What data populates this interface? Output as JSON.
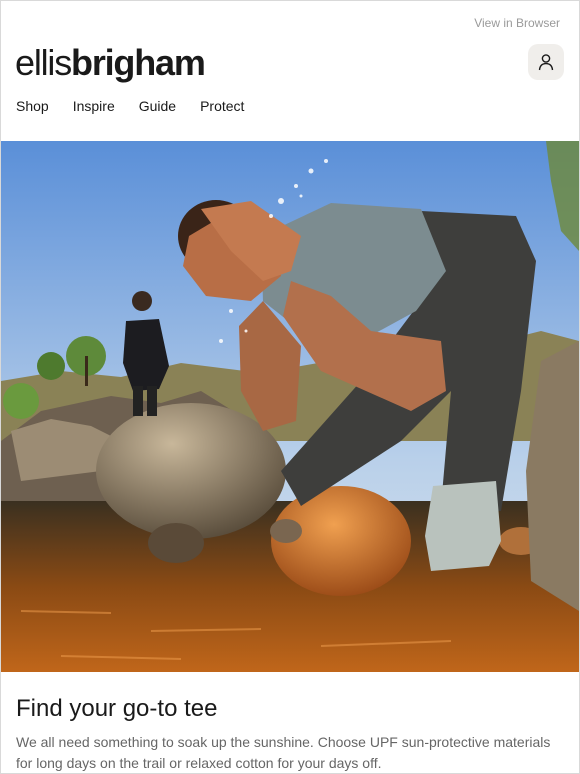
{
  "header": {
    "view_in_browser": "View in Browser",
    "brand_light": "ellis",
    "brand_bold": "brigham"
  },
  "nav": {
    "items": [
      "Shop",
      "Inspire",
      "Guide",
      "Protect"
    ]
  },
  "hero": {
    "icon": "user-icon",
    "description_icon": "hero-photo"
  },
  "content": {
    "headline": "Find your go-to tee",
    "body": "We all need something to soak up the sunshine. Choose UPF sun-protective materials for long days on the trail or relaxed cotton for your days off."
  },
  "colors": {
    "text": "#1a1a1a",
    "muted": "#666666",
    "link_muted": "#9a9a9a",
    "account_bg": "#f0eeeb"
  }
}
